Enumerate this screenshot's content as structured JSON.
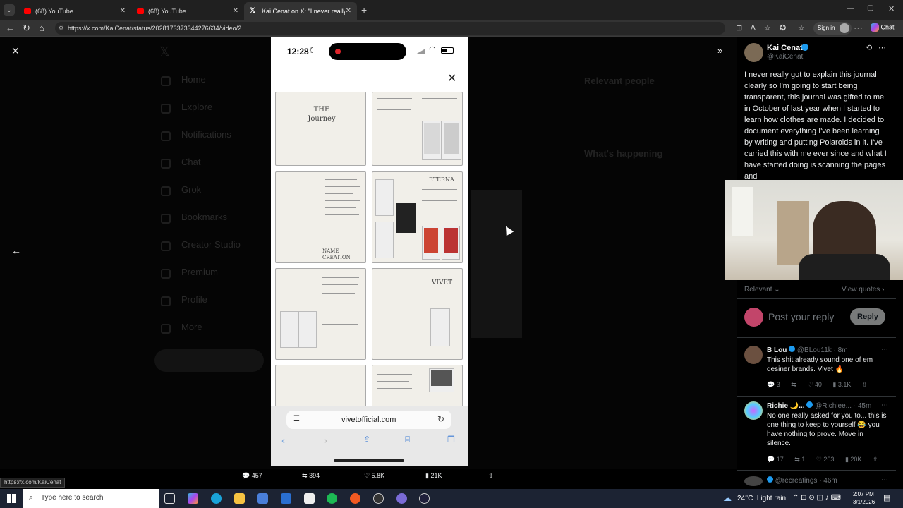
{
  "browser": {
    "tabs": [
      {
        "label": "(68) YouTube"
      },
      {
        "label": "(68) YouTube"
      },
      {
        "label": "Kai Cenat on X: \"I never really got"
      }
    ],
    "url": "https://x.com/KaiCenat/status/2028173373344276634/video/2",
    "signin_label": "Sign in",
    "chat_label": "Chat"
  },
  "phone": {
    "time": "12:28",
    "url": "vivetofficial.com"
  },
  "tweet": {
    "author_name": "Kai Cenat",
    "author_handle": "@KaiCenat",
    "text": "I never really got to explain this journal clearly so I'm going to start being transparent, this journal was gifted to me in October of last year when I started to learn how clothes are made. I decided to document everything I've been learning by writing and putting Polaroids in it. I've carried this with me ever since and what I have started doing is scanning the pages and",
    "relevant_label": "Relevant",
    "view_quotes_label": "View quotes",
    "reply_placeholder": "Post your reply",
    "reply_button": "Reply"
  },
  "media_actions": {
    "replies": "457",
    "reposts": "394",
    "likes": "5.8K",
    "views": "21K"
  },
  "replies": [
    {
      "name": "B Lou",
      "handle": "@BLou11k",
      "time": "· 8m",
      "text": "This shit already sound one of em desiner brands. Vivet 🔥",
      "replies": "3",
      "reposts": "",
      "likes": "40",
      "views": "3.1K"
    },
    {
      "name": "Richie 🌙...",
      "handle": "@Richiee...",
      "time": "· 45m",
      "text": "No one really asked for you to... this is one thing to keep to yourself 😂 you have nothing to prove. Move in silence.",
      "replies": "17",
      "reposts": "1",
      "likes": "263",
      "views": "20K"
    },
    {
      "name": "",
      "handle": "@recreatings",
      "time": "· 46m",
      "text": "",
      "replies": "",
      "reposts": "",
      "likes": "",
      "views": ""
    }
  ],
  "journal": {
    "page1_title": "THE Journey",
    "page3_title": "ETERNA",
    "page4_caption": "NAME CREATION",
    "page6_title": "VIVET"
  },
  "status_link": "https://x.com/KaiCenat",
  "taskbar": {
    "search_placeholder": "Type here to search",
    "weather": "24°C  Light rain",
    "time": "2:07 PM",
    "date": "3/1/2026"
  },
  "dim_nav": [
    "Home",
    "Explore",
    "Notifications",
    "Chat",
    "Grok",
    "Bookmarks",
    "Creator Studio",
    "Premium",
    "Profile",
    "More"
  ],
  "dim_right": {
    "relevant_people": "Relevant people",
    "whats_happening": "What's happening"
  }
}
